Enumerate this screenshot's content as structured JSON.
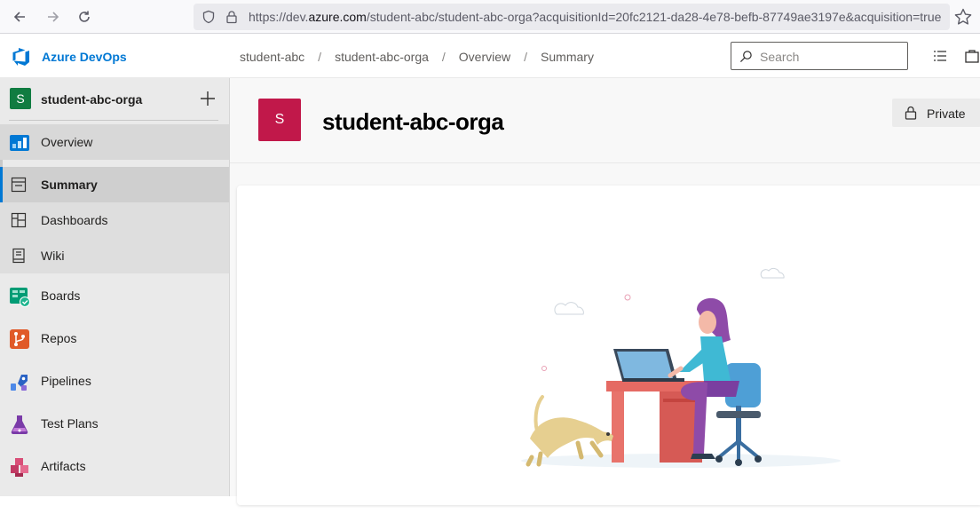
{
  "browser": {
    "url_prefix": "https://dev.",
    "url_domain": "azure.com",
    "url_rest": "/student-abc/student-abc-orga?acquisitionId=20fc2121-da28-4e78-befb-87749ae3197e&acquisition=true"
  },
  "header": {
    "brand": "Azure DevOps",
    "breadcrumbs": [
      "student-abc",
      "student-abc-orga",
      "Overview",
      "Summary"
    ],
    "search_placeholder": "Search"
  },
  "sidebar": {
    "project_initial": "S",
    "project_name": "student-abc-orga",
    "items": [
      {
        "label": "Overview"
      },
      {
        "label": "Summary"
      },
      {
        "label": "Dashboards"
      },
      {
        "label": "Wiki"
      },
      {
        "label": "Boards"
      },
      {
        "label": "Repos"
      },
      {
        "label": "Pipelines"
      },
      {
        "label": "Test Plans"
      },
      {
        "label": "Artifacts"
      }
    ]
  },
  "main": {
    "avatar_initial": "S",
    "title": "student-abc-orga",
    "visibility": "Private"
  },
  "colors": {
    "accent": "#0078d4",
    "project_badge": "#107c41",
    "project_avatar": "#c1184a"
  }
}
